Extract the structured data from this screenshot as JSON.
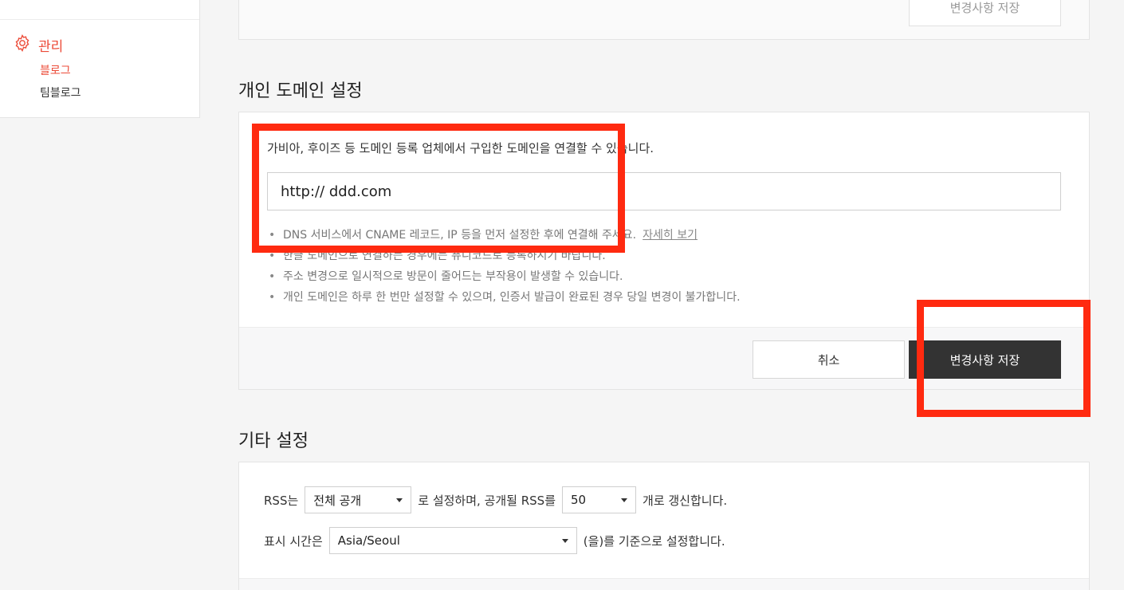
{
  "sidebar": {
    "group_label": "관리",
    "items": [
      {
        "label": "블로그",
        "active": true
      },
      {
        "label": "팀블로그",
        "active": false
      }
    ],
    "group_icon": "gear-icon",
    "accent_color": "#ec4b38"
  },
  "top_card": {
    "save_label": "변경사항 저장"
  },
  "domain_section": {
    "title": "개인 도메인 설정",
    "description": "가비아, 후이즈 등 도메인 등록 업체에서 구입한 도메인을 연결할 수 있습니다.",
    "input_value": "http://  ddd.com",
    "notes": [
      "DNS 서비스에서 CNAME 레코드, IP 등을 먼저 설정한 후에 연결해 주세요.",
      "한글 도메인으로 연결하는 경우에는 퓨니코드로 등록하시기 바랍니다.",
      "주소 변경으로 일시적으로 방문이 줄어드는 부작용이 발생할 수 있습니다.",
      "개인 도메인은 하루 한 번만 설정할 수 있으며, 인증서 발급이 완료된 경우 당일 변경이 불가합니다."
    ],
    "detail_link": "자세히 보기",
    "cancel_label": "취소",
    "save_label": "변경사항 저장"
  },
  "etc_section": {
    "title": "기타 설정",
    "rss_prefix": "RSS는",
    "rss_visibility": "전체 공개",
    "rss_middle": "로 설정하며, 공개될 RSS를",
    "rss_count": "50",
    "rss_suffix": "개로 갱신합니다.",
    "time_prefix": "표시 시간은",
    "timezone": "Asia/Seoul",
    "time_suffix": "(을)를 기준으로 설정합니다."
  }
}
